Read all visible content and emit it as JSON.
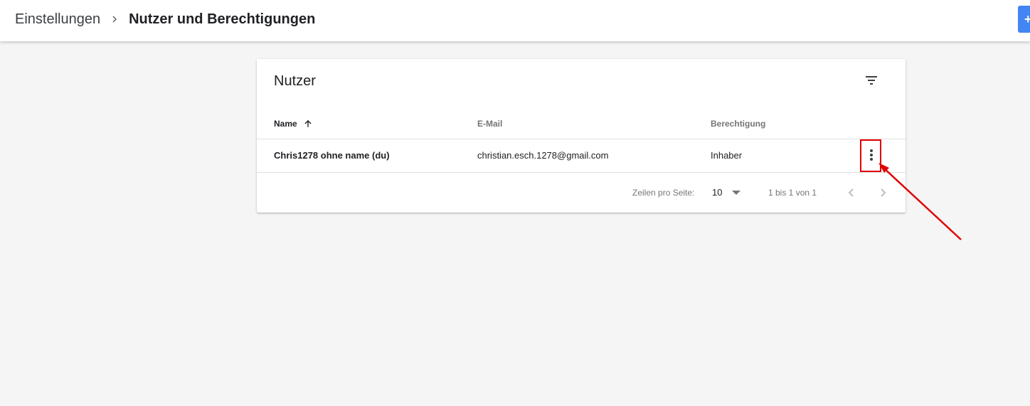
{
  "header": {
    "breadcrumb_parent": "Einstellungen",
    "breadcrumb_current": "Nutzer und Berechtigungen",
    "add_button_label": "+"
  },
  "card": {
    "title": "Nutzer",
    "columns": {
      "name": "Name",
      "email": "E-Mail",
      "permission": "Berechtigung"
    },
    "rows": [
      {
        "name": "Chris1278 ohne name (du)",
        "email": "christian.esch.1278@gmail.com",
        "permission": "Inhaber"
      }
    ],
    "pagination": {
      "rows_per_page_label": "Zeilen pro Seite:",
      "rows_per_page_value": "10",
      "range_label": "1 bis 1 von 1"
    }
  },
  "icons": {
    "breadcrumb_separator": "chevron-right-icon",
    "filter": "filter-list-icon",
    "sort": "arrow-upward-icon",
    "row_menu": "more-vert-icon",
    "dropdown": "arrow-drop-down-icon",
    "prev": "chevron-left-icon",
    "next": "chevron-right-icon"
  },
  "colors": {
    "accent": "#4285f4",
    "annotation": "#e00000",
    "background": "#f5f5f5"
  }
}
